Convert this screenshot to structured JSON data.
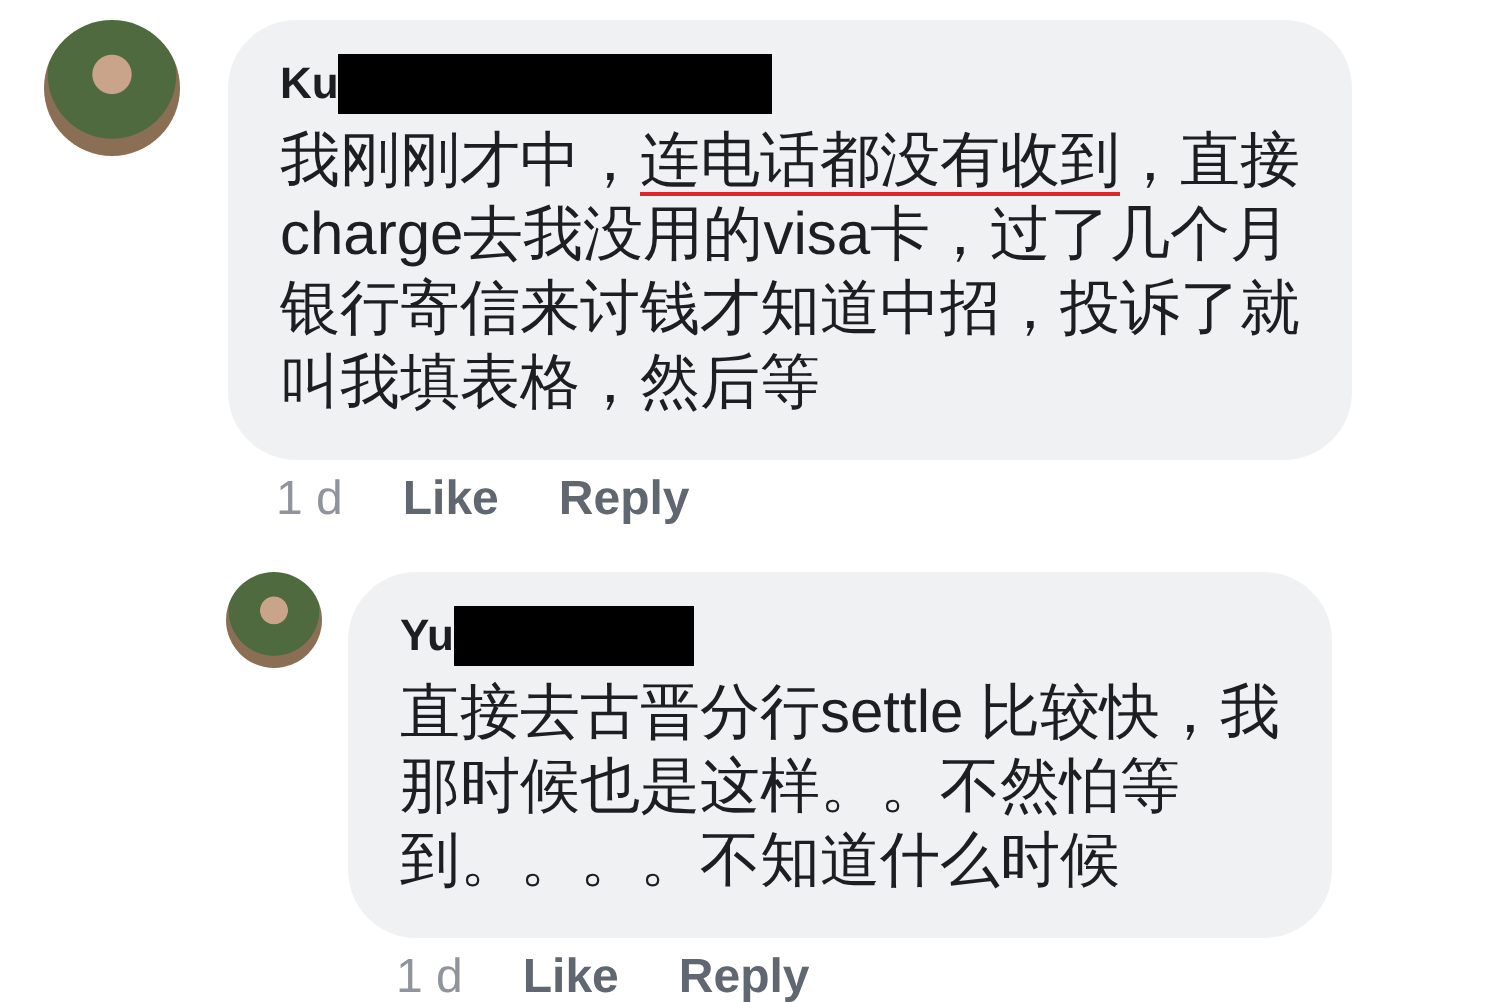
{
  "comments": [
    {
      "kind": "comment",
      "author": "Ku",
      "author_redacted": true,
      "lines": [
        [
          {
            "text": "我刚刚才中，",
            "underlined": false
          },
          {
            "text": "连电话都没有收到",
            "underlined": true
          },
          {
            "text": "，直接",
            "underlined": false
          }
        ],
        [
          {
            "text": "charge去我没用的visa卡，过了几个月",
            "underlined": false
          }
        ],
        [
          {
            "text": "银行寄信来讨钱才知道中招，投诉了就",
            "underlined": false
          }
        ],
        [
          {
            "text": "叫我填表格，然后等",
            "underlined": false
          }
        ]
      ],
      "time": "1 d",
      "actions": [
        "Like",
        "Reply"
      ]
    },
    {
      "kind": "reply",
      "author": "Yu",
      "author_redacted": true,
      "lines": [
        [
          {
            "text": "直接去古晋分行settle 比较快，我",
            "underlined": false
          }
        ],
        [
          {
            "text": "那时候也是这样。。不然怕等",
            "underlined": false
          }
        ],
        [
          {
            "text": "到。。。。不知道什么时候",
            "underlined": false
          }
        ]
      ],
      "time": "1 d",
      "actions": [
        "Like",
        "Reply"
      ]
    }
  ]
}
